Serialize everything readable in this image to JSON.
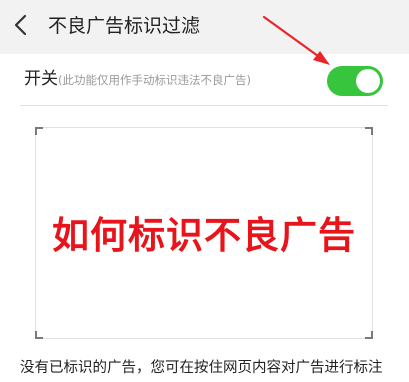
{
  "header": {
    "title": "不良广告标识过滤",
    "back_icon": "chevron-left-icon"
  },
  "switch_row": {
    "label": "开关",
    "note": "(此功能仅用作手动标识违法不良广告)",
    "toggle_state": "on",
    "toggle_color": "#36c53c"
  },
  "annotation": {
    "arrow_color": "#e8262a"
  },
  "demo": {
    "text": "如何标识不良广告",
    "text_color": "#e8141b"
  },
  "footer": {
    "text": "没有已标识的广告，您可在按住网页内容对广告进行标注"
  }
}
